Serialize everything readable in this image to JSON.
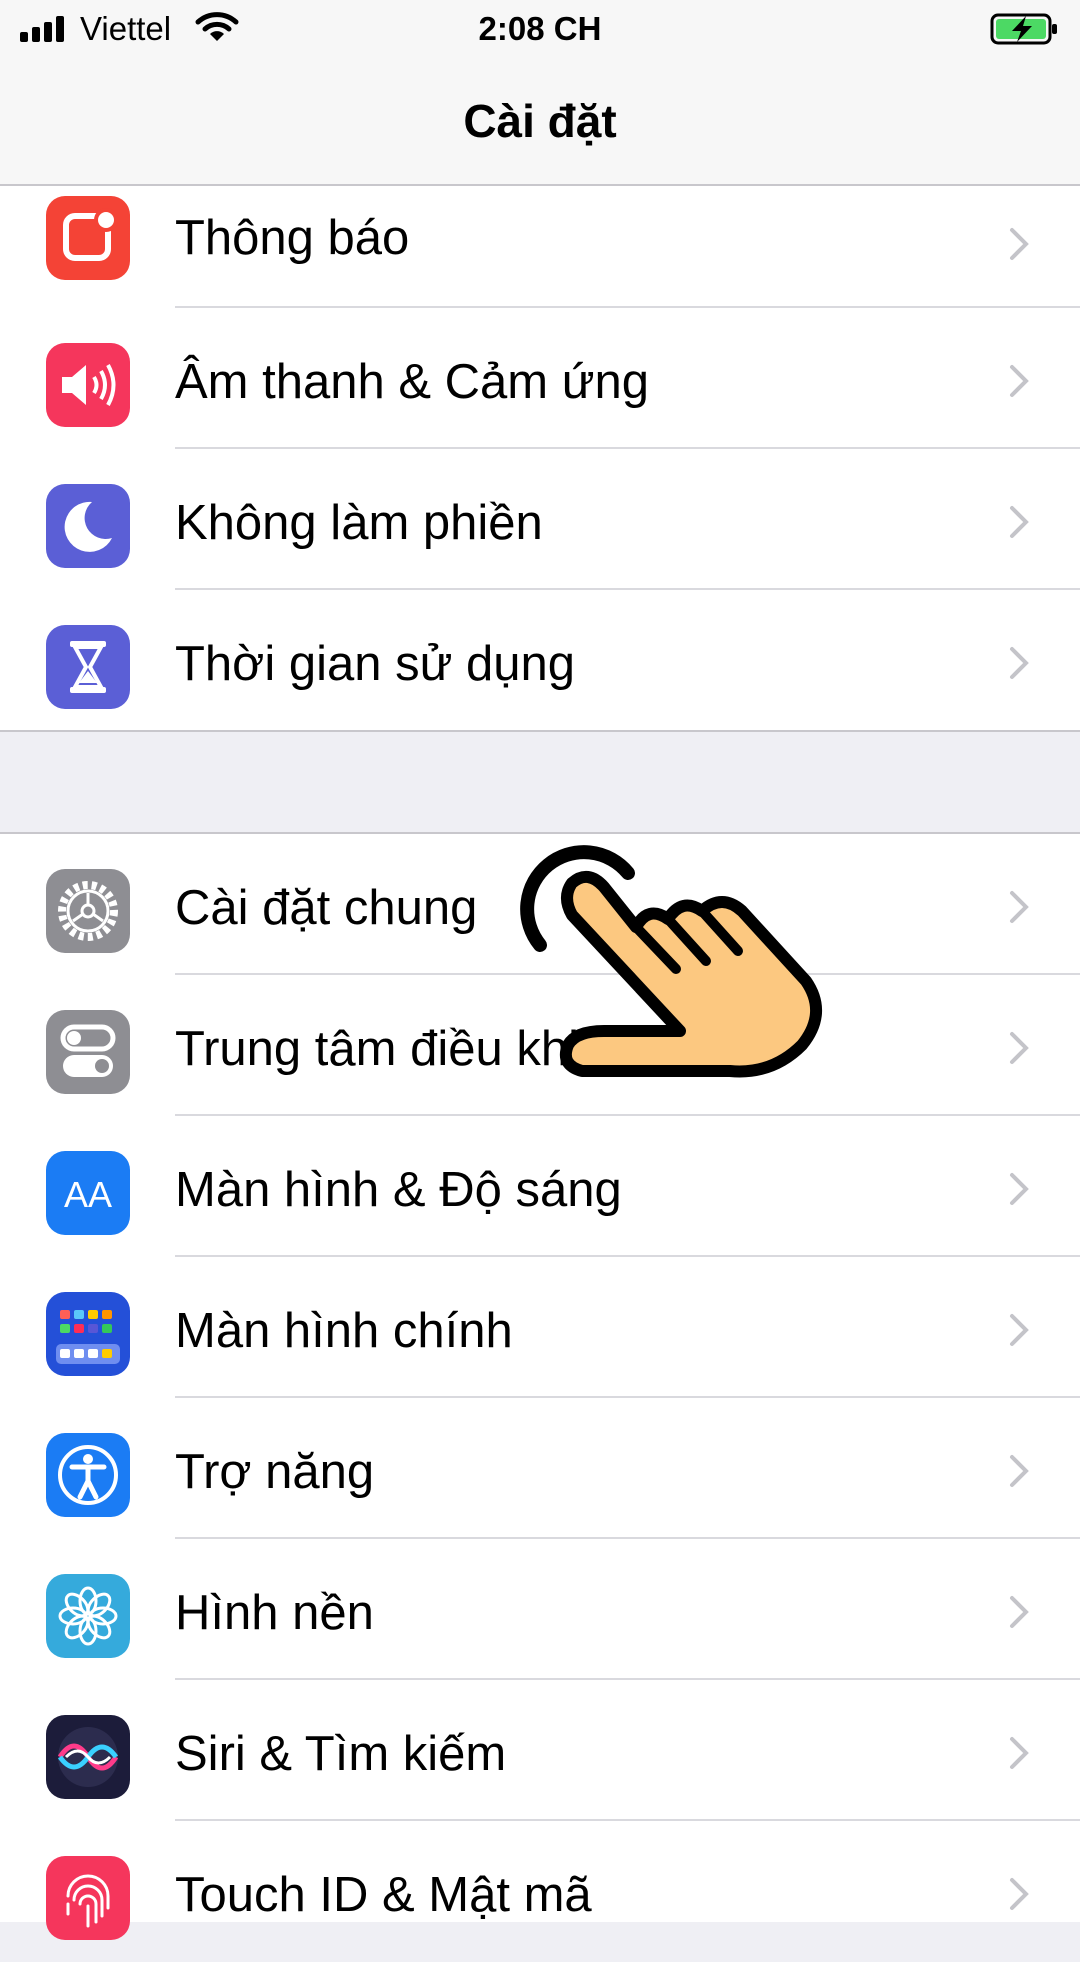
{
  "status_bar": {
    "carrier": "Viettel",
    "time": "2:08 CH",
    "battery_color": "#4cd964"
  },
  "nav": {
    "title": "Cài đặt"
  },
  "group1": [
    {
      "label": "Thông báo",
      "icon": "notifications-icon",
      "color": "#f44336"
    },
    {
      "label": "Âm thanh & Cảm ứng",
      "icon": "sounds-icon",
      "color": "#f5365c"
    },
    {
      "label": "Không làm phiền",
      "icon": "moon-icon",
      "color": "#5b5fd6"
    },
    {
      "label": "Thời gian sử dụng",
      "icon": "hourglass-icon",
      "color": "#5b5fd6"
    }
  ],
  "group2": [
    {
      "label": "Cài đặt chung",
      "icon": "gear-icon",
      "color": "#8e8e93"
    },
    {
      "label": "Trung tâm điều khiển",
      "icon": "control-center-icon",
      "color": "#8e8e93"
    },
    {
      "label": "Màn hình & Độ sáng",
      "icon": "display-icon",
      "color": "#1b7cf4"
    },
    {
      "label": "Màn hình chính",
      "icon": "home-screen-icon",
      "color": "#2450d8"
    },
    {
      "label": "Trợ năng",
      "icon": "accessibility-icon",
      "color": "#1b7cf4"
    },
    {
      "label": "Hình nền",
      "icon": "wallpaper-icon",
      "color": "#35aadc"
    },
    {
      "label": "Siri & Tìm kiếm",
      "icon": "siri-icon",
      "color": "#1c1c3a"
    },
    {
      "label": "Touch ID & Mật mã",
      "icon": "fingerprint-icon",
      "color": "#f5365c"
    }
  ]
}
